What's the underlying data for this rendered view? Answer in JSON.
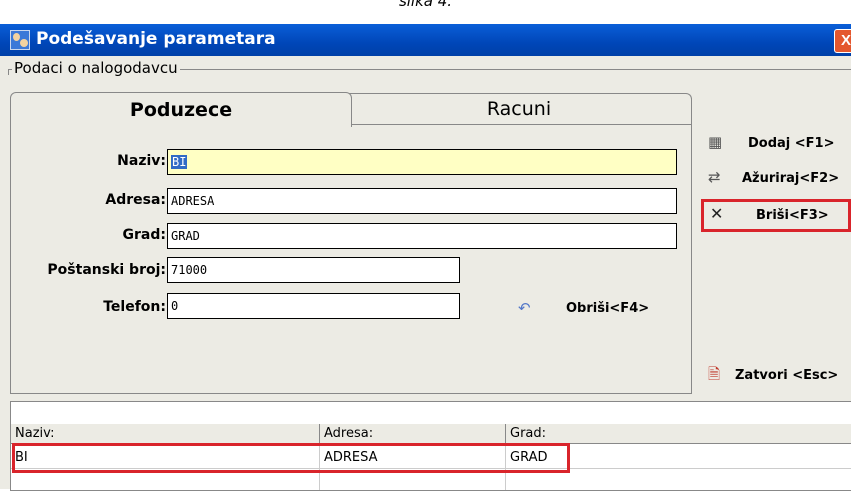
{
  "caption": "slika 4.",
  "window": {
    "title": "Podešavanje parametara",
    "close_glyph": "X"
  },
  "group": {
    "title": "Podaci o nalogodavcu"
  },
  "tabs": [
    {
      "label": "Poduzece",
      "active": true
    },
    {
      "label": "Racuni",
      "active": false
    }
  ],
  "form": {
    "naziv": {
      "label": "Naziv:",
      "value": "BI"
    },
    "adresa": {
      "label": "Adresa:",
      "value": "ADRESA"
    },
    "grad": {
      "label": "Grad:",
      "value": "GRAD"
    },
    "postanski_broj": {
      "label": "Poštanski broj:",
      "value": "71000"
    },
    "telefon": {
      "label": "Telefon:",
      "value": "0"
    }
  },
  "buttons": {
    "dodaj": {
      "label": "Dodaj <F1>",
      "icon": "add-record-icon"
    },
    "azuriraj": {
      "label": "Ažuriraj<F2>",
      "icon": "update-icon"
    },
    "brisi": {
      "label": "Briši<F3>",
      "icon": "delete-x-icon"
    },
    "obrisi": {
      "label": "Obriši<F4>",
      "icon": "undo-icon"
    },
    "zatvori": {
      "label": "Zatvori <Esc>",
      "icon": "close-document-icon"
    }
  },
  "grid": {
    "columns": [
      "Naziv:",
      "Adresa:",
      "Grad:"
    ],
    "rows": [
      [
        "BI",
        "ADRESA",
        "GRAD"
      ]
    ]
  },
  "colors": {
    "titlebar": "#0054e3",
    "highlight": "#d9242b",
    "field_yellow": "#ffffc4"
  }
}
